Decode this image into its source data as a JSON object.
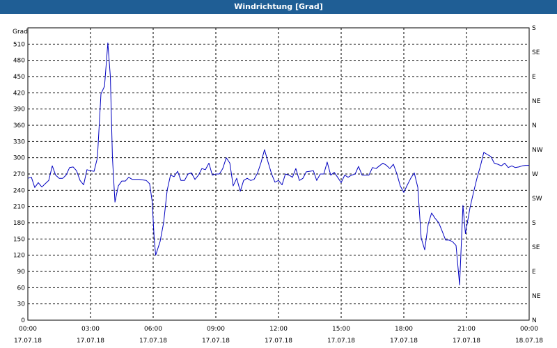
{
  "window": {
    "title": "Windrichtung [Grad]"
  },
  "chart_data": {
    "type": "line",
    "title": "Windrichtung [Grad]",
    "ylabel": "Grad",
    "ylim": [
      0,
      540
    ],
    "y_ticks": [
      0,
      30,
      60,
      90,
      120,
      150,
      180,
      210,
      240,
      270,
      300,
      330,
      360,
      390,
      420,
      450,
      480,
      510
    ],
    "y2_ticks": [
      "N",
      "NE",
      "E",
      "SE",
      "S",
      "SW",
      "W",
      "NW",
      "N",
      "NE",
      "E",
      "SE",
      "S"
    ],
    "x_ticks": [
      {
        "time": "00:00",
        "date": "17.07.18"
      },
      {
        "time": "03:00",
        "date": "17.07.18"
      },
      {
        "time": "06:00",
        "date": "17.07.18"
      },
      {
        "time": "09:00",
        "date": "17.07.18"
      },
      {
        "time": "12:00",
        "date": "17.07.18"
      },
      {
        "time": "15:00",
        "date": "17.07.18"
      },
      {
        "time": "18:00",
        "date": "17.07.18"
      },
      {
        "time": "21:00",
        "date": "17.07.18"
      },
      {
        "time": "00:00",
        "date": "18.07.18"
      }
    ],
    "xlim_hours": [
      0,
      24
    ],
    "grid": true,
    "series": [
      {
        "color": "#0000c0",
        "points": [
          [
            0.0,
            262
          ],
          [
            0.17,
            264
          ],
          [
            0.33,
            245
          ],
          [
            0.5,
            254
          ],
          [
            0.67,
            246
          ],
          [
            0.83,
            252
          ],
          [
            1.0,
            258
          ],
          [
            1.17,
            285
          ],
          [
            1.33,
            268
          ],
          [
            1.5,
            262
          ],
          [
            1.67,
            262
          ],
          [
            1.83,
            268
          ],
          [
            2.0,
            282
          ],
          [
            2.17,
            283
          ],
          [
            2.33,
            276
          ],
          [
            2.5,
            258
          ],
          [
            2.67,
            250
          ],
          [
            2.83,
            278
          ],
          [
            3.0,
            276
          ],
          [
            3.17,
            275
          ],
          [
            3.33,
            300
          ],
          [
            3.5,
            418
          ],
          [
            3.67,
            432
          ],
          [
            3.83,
            512
          ],
          [
            3.95,
            450
          ],
          [
            4.05,
            300
          ],
          [
            4.17,
            218
          ],
          [
            4.33,
            248
          ],
          [
            4.5,
            257
          ],
          [
            4.67,
            257
          ],
          [
            4.83,
            264
          ],
          [
            5.0,
            260
          ],
          [
            5.33,
            260
          ],
          [
            5.67,
            258
          ],
          [
            5.83,
            252
          ],
          [
            5.95,
            220
          ],
          [
            6.05,
            150
          ],
          [
            6.12,
            120
          ],
          [
            6.33,
            145
          ],
          [
            6.5,
            180
          ],
          [
            6.67,
            240
          ],
          [
            6.83,
            268
          ],
          [
            7.0,
            265
          ],
          [
            7.17,
            275
          ],
          [
            7.33,
            258
          ],
          [
            7.5,
            258
          ],
          [
            7.67,
            270
          ],
          [
            7.83,
            272
          ],
          [
            8.0,
            260
          ],
          [
            8.17,
            268
          ],
          [
            8.33,
            280
          ],
          [
            8.5,
            278
          ],
          [
            8.67,
            290
          ],
          [
            8.83,
            268
          ],
          [
            9.0,
            270
          ],
          [
            9.17,
            270
          ],
          [
            9.33,
            280
          ],
          [
            9.5,
            300
          ],
          [
            9.67,
            290
          ],
          [
            9.83,
            248
          ],
          [
            10.0,
            262
          ],
          [
            10.17,
            238
          ],
          [
            10.33,
            258
          ],
          [
            10.5,
            262
          ],
          [
            10.67,
            258
          ],
          [
            10.83,
            260
          ],
          [
            11.0,
            272
          ],
          [
            11.17,
            292
          ],
          [
            11.33,
            315
          ],
          [
            11.5,
            292
          ],
          [
            11.67,
            270
          ],
          [
            11.83,
            255
          ],
          [
            12.0,
            258
          ],
          [
            12.17,
            250
          ],
          [
            12.33,
            270
          ],
          [
            12.5,
            268
          ],
          [
            12.67,
            264
          ],
          [
            12.83,
            280
          ],
          [
            13.0,
            258
          ],
          [
            13.17,
            262
          ],
          [
            13.33,
            274
          ],
          [
            13.5,
            275
          ],
          [
            13.67,
            276
          ],
          [
            13.83,
            258
          ],
          [
            14.0,
            270
          ],
          [
            14.17,
            270
          ],
          [
            14.33,
            292
          ],
          [
            14.5,
            268
          ],
          [
            14.67,
            273
          ],
          [
            14.83,
            264
          ],
          [
            15.0,
            254
          ],
          [
            15.17,
            268
          ],
          [
            15.33,
            264
          ],
          [
            15.5,
            268
          ],
          [
            15.67,
            270
          ],
          [
            15.83,
            284
          ],
          [
            16.0,
            268
          ],
          [
            16.17,
            268
          ],
          [
            16.33,
            268
          ],
          [
            16.5,
            282
          ],
          [
            16.67,
            280
          ],
          [
            16.83,
            285
          ],
          [
            17.0,
            290
          ],
          [
            17.17,
            286
          ],
          [
            17.33,
            280
          ],
          [
            17.5,
            288
          ],
          [
            17.67,
            270
          ],
          [
            17.83,
            248
          ],
          [
            18.0,
            236
          ],
          [
            18.17,
            250
          ],
          [
            18.33,
            262
          ],
          [
            18.5,
            272
          ],
          [
            18.67,
            245
          ],
          [
            18.83,
            152
          ],
          [
            19.0,
            130
          ],
          [
            19.17,
            178
          ],
          [
            19.33,
            198
          ],
          [
            19.5,
            188
          ],
          [
            19.67,
            180
          ],
          [
            19.83,
            165
          ],
          [
            20.0,
            148
          ],
          [
            20.17,
            148
          ],
          [
            20.33,
            145
          ],
          [
            20.5,
            138
          ],
          [
            20.67,
            65
          ],
          [
            20.83,
            212
          ],
          [
            20.95,
            160
          ],
          [
            21.17,
            208
          ],
          [
            21.33,
            235
          ],
          [
            21.5,
            262
          ],
          [
            21.67,
            285
          ],
          [
            21.83,
            310
          ],
          [
            22.0,
            306
          ],
          [
            22.17,
            302
          ],
          [
            22.33,
            290
          ],
          [
            22.5,
            288
          ],
          [
            22.67,
            285
          ],
          [
            22.83,
            290
          ],
          [
            23.0,
            282
          ],
          [
            23.17,
            285
          ],
          [
            23.33,
            282
          ],
          [
            23.5,
            283
          ],
          [
            23.67,
            285
          ],
          [
            23.83,
            286
          ],
          [
            24.0,
            286
          ]
        ]
      }
    ]
  }
}
